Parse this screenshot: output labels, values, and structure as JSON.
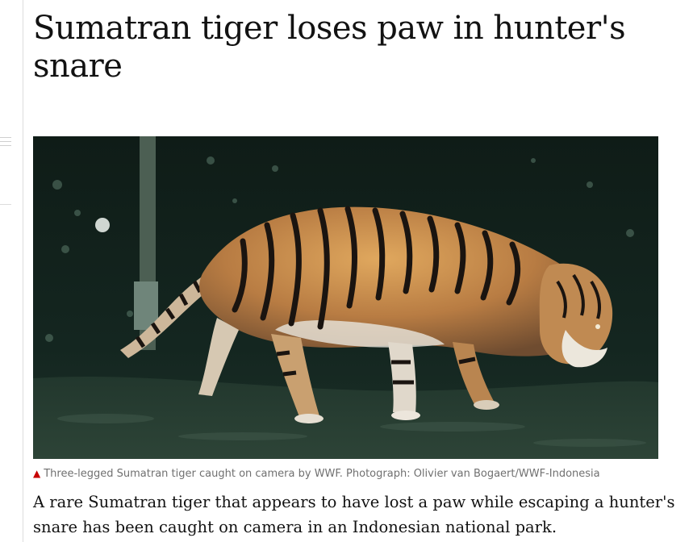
{
  "article": {
    "headline": "Sumatran tiger loses paw in hunter's snare",
    "image": {
      "subject": "tiger"
    },
    "caption": {
      "icon": "triangle-up-icon",
      "text": "Three-legged Sumatran tiger caught on camera by WWF. Photograph: Olivier van Bogaert/WWF-Indonesia"
    },
    "standfirst": "A rare Sumatran tiger that appears to have lost a paw while escaping a hunter's snare has been caught on camera in an Indonesian national park."
  },
  "colors": {
    "text": "#121212",
    "caption_text": "#707070",
    "caption_icon": "#c70000",
    "rule": "#dcdcdc"
  }
}
